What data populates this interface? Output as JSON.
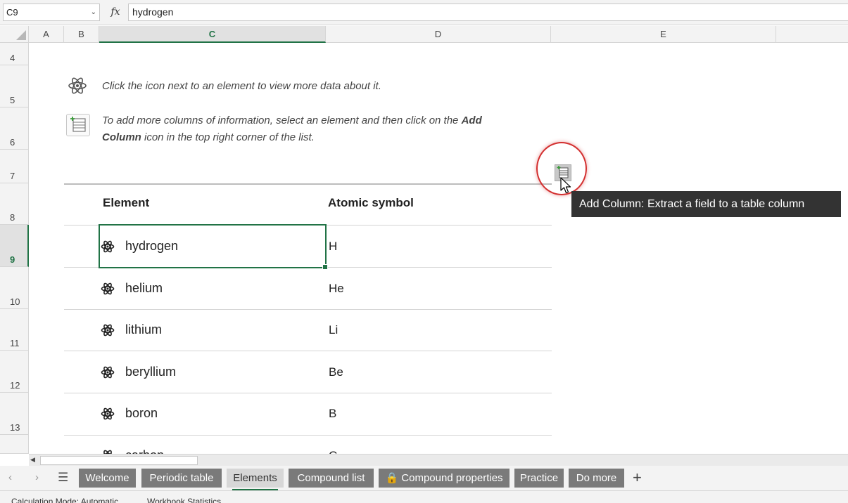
{
  "formula_bar": {
    "name_box": "C9",
    "fx_label": "fx",
    "formula_value": "hydrogen"
  },
  "columns": [
    "A",
    "B",
    "C",
    "D",
    "E"
  ],
  "rows": [
    "4",
    "5",
    "6",
    "7",
    "8",
    "9",
    "10",
    "11",
    "12",
    "13"
  ],
  "selected_column": "C",
  "selected_row": "9",
  "instructions": {
    "line1": "Click the icon next to an element to view more data about it.",
    "line2_part1": "To add more columns of information, select an element and then click on the ",
    "line2_bold1": "Add",
    "line2_bold2": "Column",
    "line2_part2": " icon in the top right corner of the list."
  },
  "table": {
    "headers": [
      "Element",
      "Atomic symbol"
    ],
    "rows": [
      {
        "element": "hydrogen",
        "symbol": "H"
      },
      {
        "element": "helium",
        "symbol": "He"
      },
      {
        "element": "lithium",
        "symbol": "Li"
      },
      {
        "element": "beryllium",
        "symbol": "Be"
      },
      {
        "element": "boron",
        "symbol": "B"
      },
      {
        "element": "carbon",
        "symbol": "C"
      }
    ]
  },
  "tooltip": "Add Column: Extract a field to a table column",
  "sheet_tabs": [
    {
      "label": "Welcome",
      "active": false
    },
    {
      "label": "Periodic table",
      "active": false
    },
    {
      "label": "Elements",
      "active": true
    },
    {
      "label": "Compound list",
      "active": false
    },
    {
      "label": "Compound properties",
      "active": false,
      "locked": true
    },
    {
      "label": "Practice",
      "active": false
    },
    {
      "label": "Do more",
      "active": false
    }
  ],
  "status": {
    "calc_mode": "Calculation Mode: Automatic",
    "workbook_stats": "Workbook Statistics"
  },
  "colors": {
    "accent": "#217346",
    "tab_bg": "#7a7a7a",
    "highlight": "#d32f2f"
  },
  "icons": [
    "atom-icon",
    "add-column-icon",
    "chevron-down-icon",
    "hamburger-menu-icon",
    "plus-icon",
    "lock-icon",
    "arrow-cursor-icon"
  ]
}
